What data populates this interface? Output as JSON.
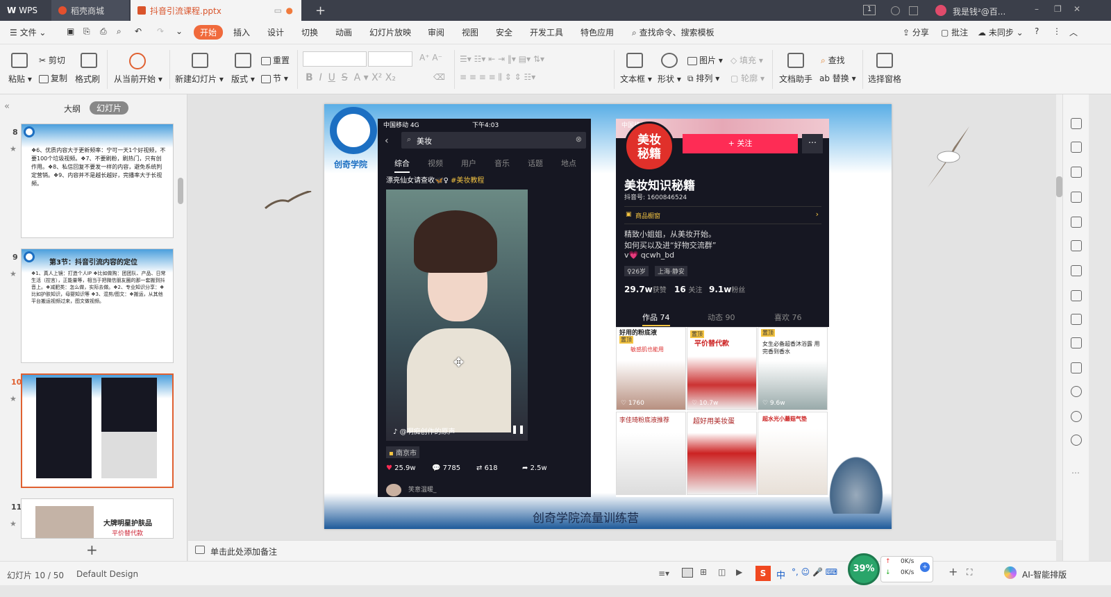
{
  "titlebar": {
    "wps": "WPS",
    "tab1": "稻壳商城",
    "tab2": "抖音引流课程.pptx",
    "add": "+",
    "badge": "1",
    "user": "我是钱²@百..."
  },
  "menu": {
    "file": "文件",
    "items": [
      "开始",
      "插入",
      "设计",
      "切换",
      "动画",
      "幻灯片放映",
      "审阅",
      "视图",
      "安全",
      "开发工具",
      "特色应用"
    ],
    "search": "查找命令、搜索模板",
    "share": "分享",
    "comment": "批注",
    "sync": "未同步",
    "help": "?"
  },
  "ribbon": {
    "paste": "粘贴",
    "cut": "剪切",
    "copy": "复制",
    "format_painter": "格式刷",
    "from_start": "从当前开始",
    "new_slide": "新建幻灯片",
    "layout": "版式",
    "reset": "重置",
    "section": "节",
    "textbox": "文本框",
    "shape": "形状",
    "picture": "图片",
    "arrange": "排列",
    "fill": "填充",
    "outline": "轮廓",
    "doc_helper": "文档助手",
    "find": "查找",
    "replace": "替换",
    "select_pane": "选择窗格"
  },
  "panel": {
    "outline": "大纲",
    "slides": "幻灯片",
    "collapse": "«",
    "add": "+"
  },
  "thumbs": [
    {
      "num": "8",
      "text": "❖6、优质内容大于更新频率：宁可一天1个好视频，不要100个垃圾视频。❖7、不要刷粉，刷热门，只有创作用。❖8、私信回复不要发一样的内容，避免系统判定营销。❖9、内容并不是越长越好，完播率大于长视频。"
    },
    {
      "num": "9",
      "title": "第3节：抖音引流内容的定位",
      "text": "❖1、真人上镜：打造个人IP ❖比如做购：团团队、产品、日常生活（控言），正能量等，相当于把微信朋友圈的那一套搬到抖音上。❖减肥类：怎么做，实际去做。❖2、专业知识分享：❖比如护肤知识，母婴知识等 ❖3、混剪/图文：❖搬运，从其他平台搬运视频过来，图文做视频。"
    },
    {
      "num": "10"
    },
    {
      "num": "11",
      "title": "大牌明星护肤品",
      "sub": "平价替代款"
    }
  ],
  "slide": {
    "logo_text": "创奇学院",
    "footer": "创奇学院流量训练营",
    "left_phone": {
      "carrier": "中国移动  4G",
      "time": "下午4:03",
      "search": "美妆",
      "tabs": [
        "综合",
        "视频",
        "用户",
        "音乐",
        "话题",
        "地点"
      ],
      "caption": "漂亮仙女请查收🦋♀ ",
      "hashtag": "#美妆教程",
      "music": "@啊痴创作的原声",
      "location": "南京市",
      "likes": "25.9w",
      "comments": "7785",
      "shares_count": "618",
      "forwards": "2.5w",
      "commenter": "笑意温暖_"
    },
    "right_phone": {
      "carrier": "中国移动  4G",
      "avatar_text": "美妆秘籍",
      "follow": "+ 关注",
      "name": "美妆知识秘籍",
      "id": "抖音号: 1600846524",
      "shop": "商品橱窗",
      "bio1": "精致小姐姐，从美妆开始。",
      "bio2": "如何买以及进“好物交流群”",
      "bio3": "v💗 qcwh_bd",
      "tag_age": "♀26岁",
      "tag_loc": "上海·静安",
      "likes": "29.7w",
      "likes_label": "获赞",
      "follow_count": "16",
      "follow_label": "关注",
      "fans": "9.1w",
      "fans_label": "粉丝",
      "tabs": [
        "作品 74",
        "动态 90",
        "喜欢 76"
      ]
    },
    "grid": [
      {
        "title": "好用的粉底液",
        "badge": "置顶",
        "sub": "敏感肌也能用",
        "count": "♡ 1760"
      },
      {
        "title": "平价替代款",
        "badge": "置顶",
        "sub": "",
        "count": "♡ 10.7w"
      },
      {
        "title": "超香沐浴露",
        "badge": "置顶",
        "sub": "女生必备超香沐浴露 用完香到香水",
        "count": "♡ 9.6w"
      },
      {
        "title": "李佳琦粉底液推荐",
        "badge": "",
        "sub": "",
        "count": ""
      },
      {
        "title": "超好用美妆蛋",
        "badge": "",
        "sub": "",
        "count": ""
      },
      {
        "title": "超水光小蘑菇气垫",
        "badge": "",
        "sub": "",
        "count": ""
      }
    ]
  },
  "notes": {
    "placeholder": "单击此处添加备注"
  },
  "status": {
    "slide_info": "幻灯片 10 / 50",
    "theme": "Default Design",
    "zoom_pct": "39%",
    "net_up": "0K/s",
    "net_down": "0K/s",
    "ai": "AI-智能排版",
    "ime": "中"
  },
  "colors": {
    "accent": "#f06a3c",
    "tiktok_red": "#fe2c55",
    "dark": "#161722"
  }
}
